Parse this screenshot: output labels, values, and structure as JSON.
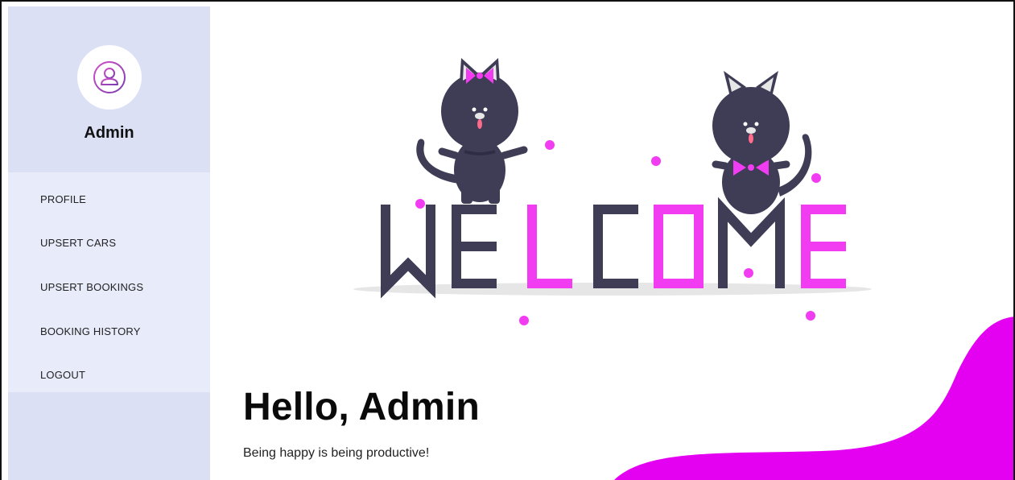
{
  "sidebar": {
    "user": {
      "name": "Admin",
      "avatar_icon": "user-icon"
    },
    "menu": [
      {
        "label": "PROFILE"
      },
      {
        "label": "UPSERT CARS"
      },
      {
        "label": "UPSERT BOOKINGS"
      },
      {
        "label": "BOOKING HISTORY"
      },
      {
        "label": "LOGOUT"
      }
    ]
  },
  "main": {
    "greeting": "Hello, Admin",
    "tagline": "Being happy is being productive!",
    "illustration": {
      "word": [
        "W",
        "E",
        "L",
        "C",
        "O",
        "M",
        "E"
      ]
    }
  },
  "colors": {
    "sidebar_top": "#dce0f5",
    "sidebar_menu": "#e8ebfa",
    "accent_pink": "#f23cf2",
    "blob_magenta": "#e400f0",
    "cat_dark": "#3f3d56"
  }
}
